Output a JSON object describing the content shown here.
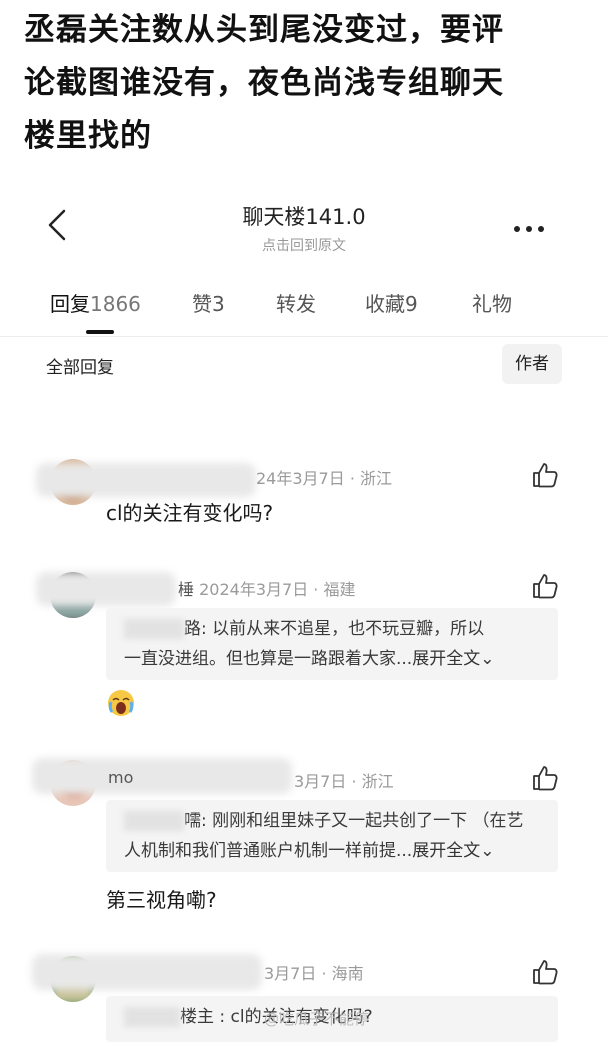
{
  "caption": {
    "line1": "丞磊关注数从头到尾没变过，要评",
    "line2": "论截图谁没有，夜色尚浅专组聊天",
    "line3": "楼里找的"
  },
  "header": {
    "title": "聊天楼141.0",
    "subtitle": "点击回到原文"
  },
  "tabs": [
    {
      "label": "回复",
      "count": "1866"
    },
    {
      "label": "赞",
      "count": "3"
    },
    {
      "label": "转发",
      "count": ""
    },
    {
      "label": "收藏",
      "count": "9"
    },
    {
      "label": "礼物",
      "count": ""
    }
  ],
  "filter": {
    "all_replies": "全部回复",
    "author": "作者"
  },
  "replies": [
    {
      "meta_date": "24年3月7日",
      "meta_loc": "浙江",
      "text": "cl的关注有变化吗?"
    },
    {
      "name_tail": "棰",
      "meta_date": "2024年3月7日",
      "meta_loc": "福建",
      "quote_name_tail": "路",
      "quote_line1": ": 以前从来不追星，也不玩豆瓣，所以",
      "quote_line2": "一直没进组。但也算是一路跟着大家...",
      "quote_expand": "展开全文",
      "emoji": "crying-face"
    },
    {
      "name_head": "mo",
      "meta_date": "3月7日",
      "meta_loc": "浙江",
      "quote_name_tail": "嚅",
      "quote_line1": ": 刚刚和组里妹子又一起共创了一下 （在艺",
      "quote_line2": "人机制和我们普通账户机制一样前提...",
      "quote_expand": "展开全文",
      "text": "第三视角嘞?"
    },
    {
      "meta_date": "3月7日",
      "meta_loc": "海南",
      "quote_name_tail": "楼主",
      "quote_line1": "  : cl的关注有变化吗?"
    }
  ],
  "watermark": "@吃瓜子不能停",
  "colors": {
    "meta": "#9a9a9a",
    "quote_bg": "#f4f4f4",
    "accent": "#111111"
  }
}
